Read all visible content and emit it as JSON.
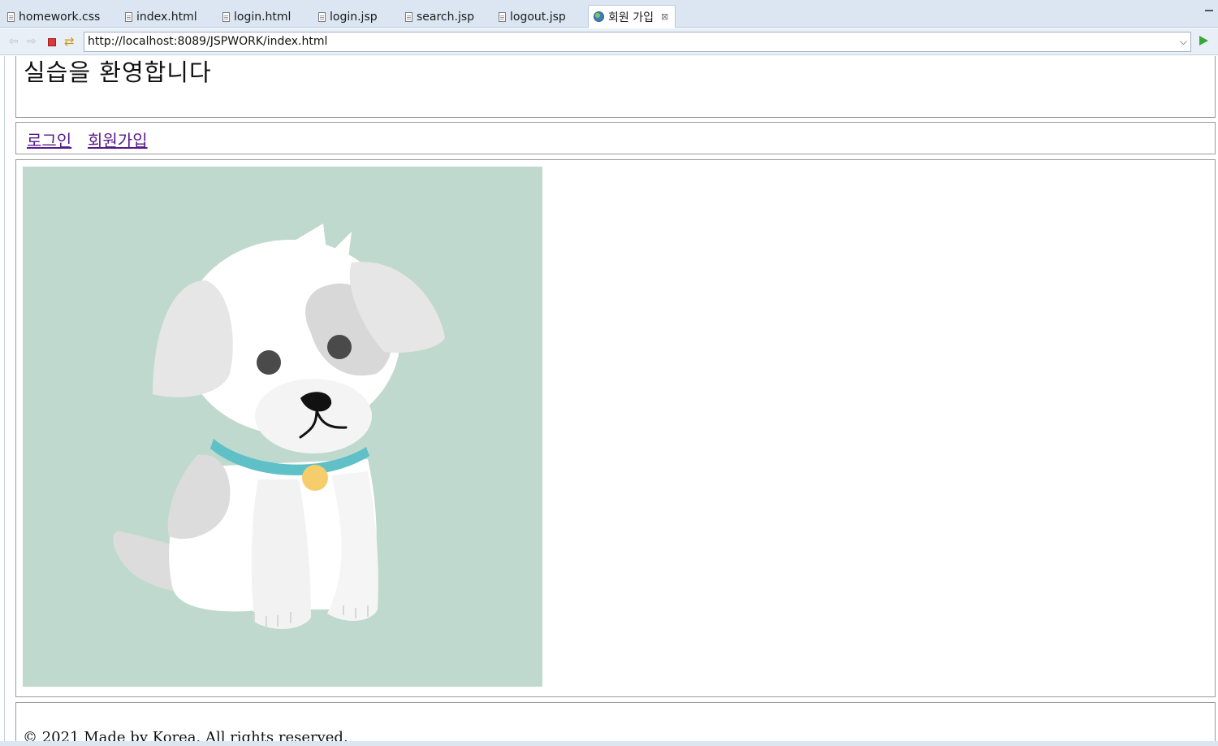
{
  "tabs": [
    {
      "label": "homework.css",
      "icon": "file-icon",
      "active": false
    },
    {
      "label": "index.html",
      "icon": "file-icon",
      "active": false
    },
    {
      "label": "login.html",
      "icon": "file-icon",
      "active": false
    },
    {
      "label": "login.jsp",
      "icon": "file-icon",
      "active": false
    },
    {
      "label": "search.jsp",
      "icon": "file-icon",
      "active": false
    },
    {
      "label": "logout.jsp",
      "icon": "file-icon",
      "active": false
    },
    {
      "label": "회원 가입",
      "icon": "globe-icon",
      "active": true
    }
  ],
  "toolbar": {
    "url": "http://localhost:8089/JSPWORK/index.html",
    "back_icon": "back-arrow-icon",
    "forward_icon": "forward-arrow-icon",
    "stop_icon": "stop-icon",
    "refresh_icon": "refresh-icon",
    "go_icon": "go-icon"
  },
  "page": {
    "title": "실습을 환영합니다",
    "nav": [
      {
        "label": "로그인"
      },
      {
        "label": "회원가입"
      }
    ],
    "image": {
      "subject": "cartoon white puppy with grey patch and teal collar",
      "background_color": "#bfd9ce"
    },
    "footer": "© 2021 Made by Korea. All rights reserved."
  },
  "colors": {
    "visited_link": "#551a8b",
    "tabbar_bg": "#dbe6f2"
  }
}
